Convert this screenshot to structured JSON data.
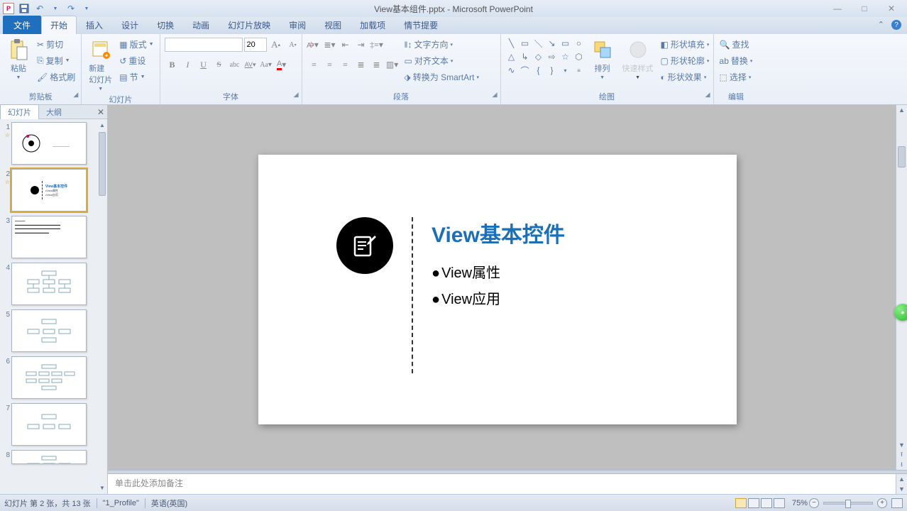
{
  "app": {
    "title": "View基本组件.pptx - Microsoft PowerPoint"
  },
  "win": {
    "min": "—",
    "max": "□",
    "close": "✕"
  },
  "qat": {
    "logo": "P",
    "save": "💾",
    "undo": "↶",
    "redo": "↷"
  },
  "tabs": {
    "file": "文件",
    "home": "开始",
    "insert": "插入",
    "design": "设计",
    "transitions": "切换",
    "animations": "动画",
    "slideshow": "幻灯片放映",
    "review": "审阅",
    "view": "视图",
    "addins": "加载项",
    "storyline": "情节提要"
  },
  "ribbon": {
    "clipboard": {
      "label": "剪贴板",
      "paste": "粘贴",
      "cut": "剪切",
      "copy": "复制",
      "painter": "格式刷"
    },
    "slides": {
      "label": "幻灯片",
      "new": "新建\n幻灯片",
      "layout": "版式",
      "reset": "重设",
      "section": "节"
    },
    "font": {
      "label": "字体",
      "size": "20"
    },
    "paragraph": {
      "label": "段落",
      "textdir": "文字方向",
      "align": "对齐文本",
      "smart": "转换为 SmartArt"
    },
    "drawing": {
      "label": "绘图",
      "arrange": "排列",
      "quick": "快速样式",
      "fill": "形状填充",
      "outline": "形状轮廓",
      "effects": "形状效果"
    },
    "editing": {
      "label": "编辑",
      "find": "查找",
      "replace": "替换",
      "select": "选择"
    }
  },
  "thumbs": {
    "tab_slides": "幻灯片",
    "tab_outline": "大纲",
    "items": [
      {
        "n": "1",
        "star": "☆"
      },
      {
        "n": "2",
        "star": "☆"
      },
      {
        "n": "3"
      },
      {
        "n": "4"
      },
      {
        "n": "5"
      },
      {
        "n": "6"
      },
      {
        "n": "7"
      },
      {
        "n": "8"
      }
    ]
  },
  "slide": {
    "title": "View基本控件",
    "bullet1": "View属性",
    "bullet2": "View应用"
  },
  "notes": {
    "placeholder": "单击此处添加备注"
  },
  "status": {
    "pos": "幻灯片 第 2 张，共 13 张",
    "theme": "\"1_Profile\"",
    "lang": "英语(英国)",
    "zoom": "75%"
  }
}
